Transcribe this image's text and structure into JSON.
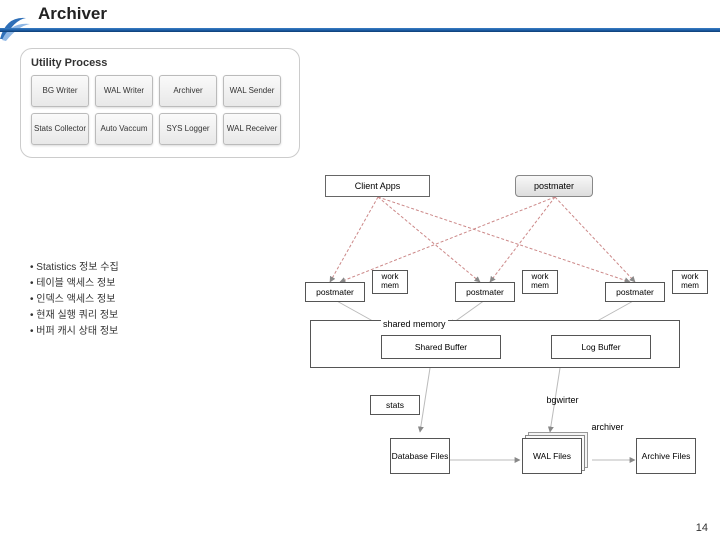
{
  "title": "Archiver",
  "panel_title": "Utility Process",
  "utility": {
    "r0c0": "BG\nWriter",
    "r0c1": "WAL\nWriter",
    "r0c2": "Archiver",
    "r0c3": "WAL\nSender",
    "r1c0": "Stats\nCollector",
    "r1c1": "Auto\nVaccum",
    "r1c2": "SYS\nLogger",
    "r1c3": "WAL\nReceiver"
  },
  "bullets": {
    "b0": "Statistics 정보 수집",
    "b1": "테이블 액세스 정보",
    "b2": "인덱스 액세스 정보",
    "b3": "현재 실행 쿼리 정보",
    "b4": "버퍼 캐시 상태 정보"
  },
  "labels": {
    "client_apps": "Client Apps",
    "postmater": "postmater",
    "work_mem": "work mem",
    "shared_memory": "shared memory",
    "shared_buffer": "Shared Buffer",
    "log_buffer": "Log Buffer",
    "stats": "stats",
    "bgwirter": "bgwirter",
    "archiver": "archiver",
    "database_files": "Database Files",
    "wal_files": "WAL Files",
    "archive_files": "Archive Files"
  },
  "page_number": "14"
}
